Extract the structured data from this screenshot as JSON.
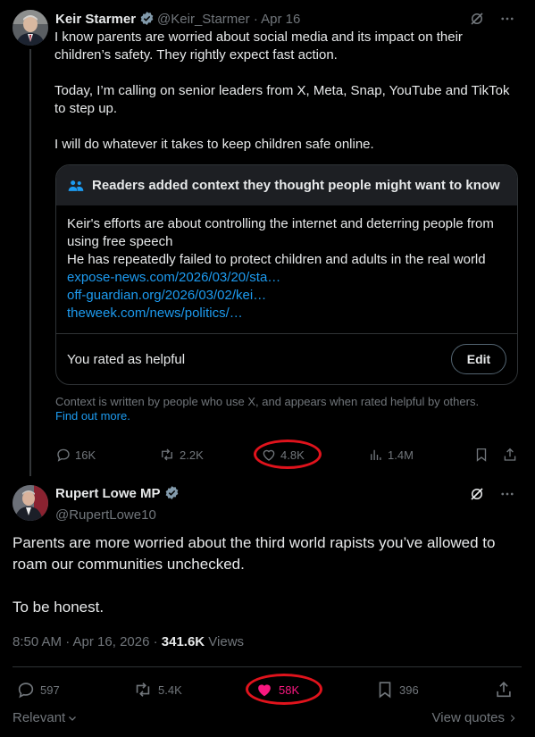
{
  "tweet1": {
    "author_name": "Keir Starmer",
    "handle": "@Keir_Starmer",
    "separator": "·",
    "date": "Apr 16",
    "paragraphs": [
      "I know parents are worried about social media and its impact on their children’s safety. They rightly expect fast action.",
      "Today, I’m calling on senior leaders from X, Meta, Snap, YouTube and TikTok to step up.",
      "I will do whatever it takes to keep children safe online."
    ],
    "community_note": {
      "header": "Readers added context they thought people might want to know",
      "lines": [
        "Keir's efforts are about controlling the internet and deterring people from using free speech",
        "He has repeatedly failed to protect children and adults in the real world"
      ],
      "links": [
        "expose-news.com/2026/03/20/sta…",
        "off-guardian.org/2026/03/02/kei…",
        "theweek.com/news/politics/…"
      ],
      "rating_text": "You rated as helpful",
      "edit_label": "Edit",
      "disclaimer": "Context is written by people who use X, and appears when rated helpful by others.",
      "find_out_more": "Find out more."
    },
    "actions": {
      "replies": "16K",
      "reposts": "2.2K",
      "likes": "4.8K",
      "views": "1.4M"
    }
  },
  "tweet2": {
    "author_name": "Rupert Lowe MP",
    "handle": "@RupertLowe10",
    "paragraphs": [
      "Parents are more worried about the third world rapists you’ve allowed to roam our communities unchecked.",
      "To be honest."
    ],
    "timestamp": "8:50 AM · Apr 16, 2026 · ",
    "views_count": "341.6K",
    "views_label": " Views",
    "actions": {
      "replies": "597",
      "reposts": "5.4K",
      "likes": "58K",
      "bookmarks": "396"
    },
    "sort_label": "Relevant",
    "view_quotes": "View quotes"
  },
  "colors": {
    "accent": "#1d9bf0",
    "like_active": "#f91880",
    "highlight": "#e0131c",
    "muted": "#71767b"
  }
}
